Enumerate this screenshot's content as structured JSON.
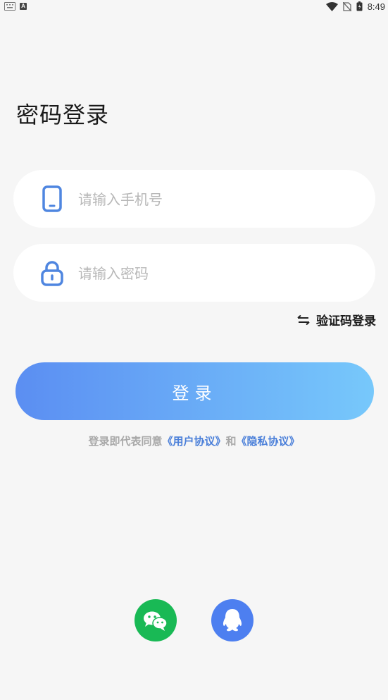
{
  "status_bar": {
    "time": "8:49",
    "left_icons": [
      "keyboard-icon",
      "a-app-icon"
    ],
    "right_icons": [
      "wifi-icon",
      "no-sim-icon",
      "battery-icon"
    ]
  },
  "page": {
    "title": "密码登录"
  },
  "form": {
    "phone": {
      "placeholder": "请输入手机号",
      "value": "",
      "icon": "phone-icon"
    },
    "password": {
      "placeholder": "请输入密码",
      "value": "",
      "icon": "lock-icon"
    },
    "switch_label": "验证码登录",
    "submit_label": "登录"
  },
  "agreement": {
    "prefix": "登录即代表同意",
    "user_agreement": "《用户协议》",
    "and": "和",
    "privacy_agreement": "《隐私协议》"
  },
  "social_login": [
    {
      "name": "wechat",
      "icon": "wechat-icon"
    },
    {
      "name": "qq",
      "icon": "qq-icon"
    }
  ],
  "colors": {
    "accent": "#5b8ef2",
    "gradient_end": "#77c8fb",
    "link": "#4a7fd9",
    "wechat": "#19b955",
    "qq": "#4d7ff0",
    "background": "#f6f6f6"
  }
}
